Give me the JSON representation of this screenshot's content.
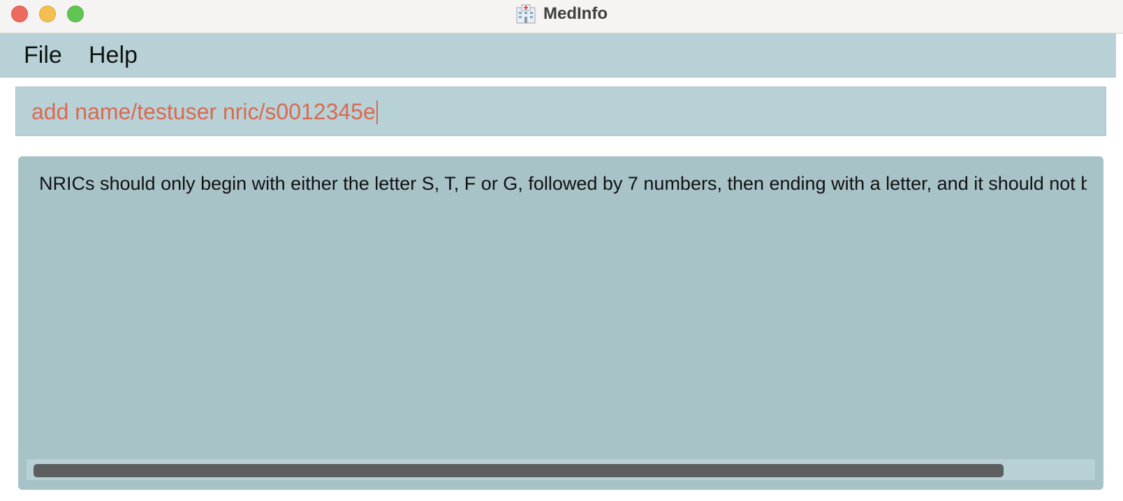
{
  "window": {
    "title": "MedInfo",
    "app_icon": "hospital-icon"
  },
  "menu": {
    "items": [
      {
        "label": "File"
      },
      {
        "label": "Help"
      }
    ]
  },
  "command_box": {
    "value": "add name/testuser nric/s0012345e"
  },
  "result_display": {
    "text": "NRICs should only begin with either the letter S, T, F or G, followed by 7 numbers, then ending with a letter, and it should not b",
    "scroll_fraction": 0.92
  },
  "colors": {
    "menubar_bg": "#b7d1d6",
    "result_bg": "#a8c3c8",
    "command_text": "#d86a52",
    "scroll_thumb": "#5c5e60"
  }
}
